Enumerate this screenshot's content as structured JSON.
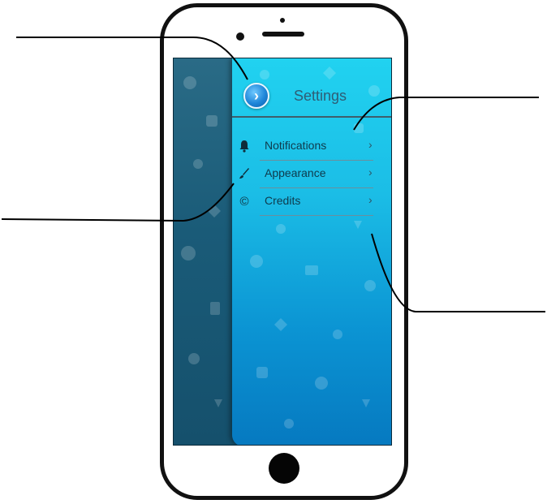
{
  "settings": {
    "title": "Settings",
    "back_button_icon": "chevron-right-icon",
    "items": [
      {
        "label": "Notifications",
        "icon": "bell-icon"
      },
      {
        "label": "Appearance",
        "icon": "brush-icon"
      },
      {
        "label": "Credits",
        "icon": "copyright-icon"
      }
    ],
    "chevron_icon": "chevron-right-icon"
  },
  "colors": {
    "panel_top": "#21d2f0",
    "panel_bottom": "#0679c0",
    "under_panel": "#1a5470",
    "title_text": "#2f5d75",
    "menu_text": "#0f3a4c"
  }
}
